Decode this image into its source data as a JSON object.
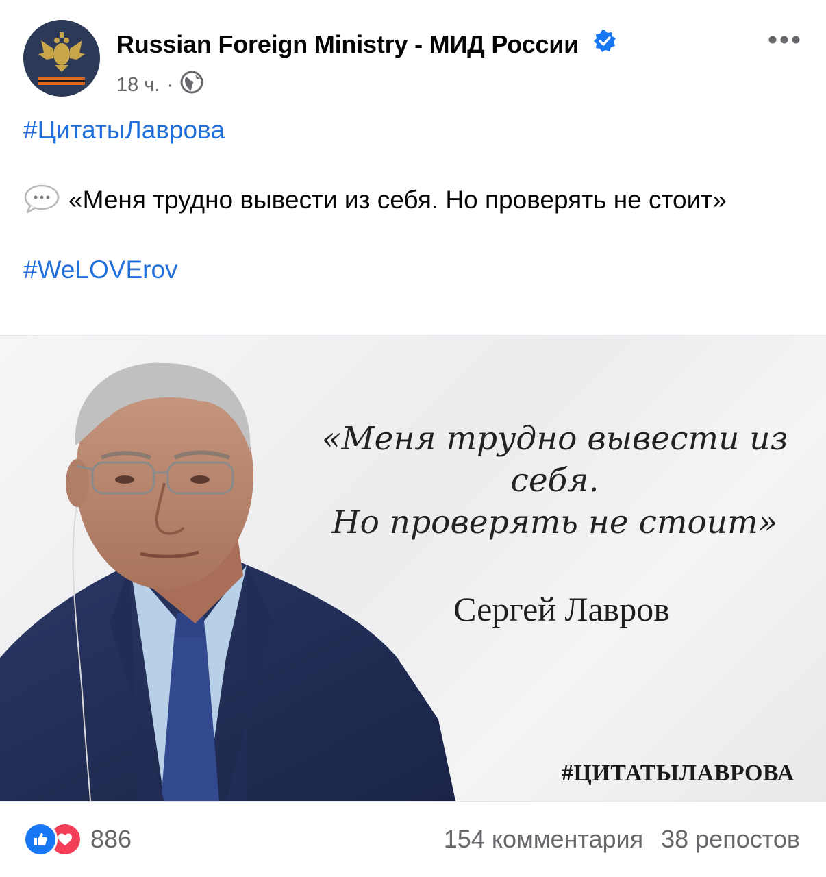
{
  "post": {
    "page_name": "Russian Foreign Ministry - МИД России",
    "time": "18 ч.",
    "dot": "·",
    "hashtag_1": "#ЦитатыЛаврова",
    "quote": "«Меня трудно вывести из себя. Но проверять не стоит»",
    "hashtag_2": "#WeLOVErov"
  },
  "image": {
    "quote_line_1": "«Меня трудно вывести из себя.",
    "quote_line_2": "Но проверять не стоит»",
    "author": "Сергей Лавров",
    "tag": "#ЦИТАТЫЛАВРОВА"
  },
  "footer": {
    "reactions_count": "886",
    "comments": "154 комментария",
    "shares": "38 репостов"
  },
  "icons": {
    "verified": "verified-badge-icon",
    "audience": "globe-icon",
    "more": "more-dots-icon",
    "speech": "speech-bubble-icon",
    "like": "like-icon",
    "love": "love-icon"
  },
  "colors": {
    "link": "#216fdb",
    "verified": "#1877f2",
    "like": "#1877f2",
    "love": "#f33e58",
    "muted": "#65676b"
  }
}
